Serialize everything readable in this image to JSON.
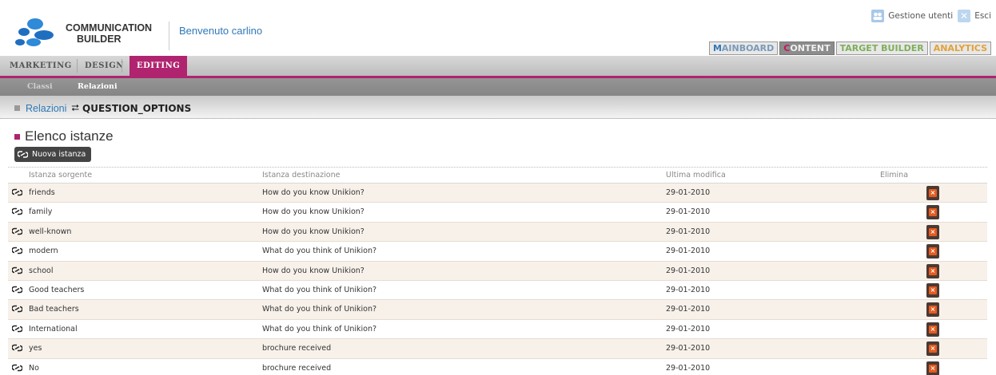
{
  "header": {
    "brand_line1": "COMMUNICATION",
    "brand_line2": "BUILDER",
    "welcome": "Benvenuto carlino",
    "user_management": "Gestione utenti",
    "logout": "Esci"
  },
  "app_tabs": [
    {
      "first": "M",
      "rest": "AINBOARD"
    },
    {
      "first": "C",
      "rest": "ONTENT"
    },
    {
      "first": "T",
      "rest": "ARGET BUILDER"
    },
    {
      "first": "A",
      "rest": "NALYTICS"
    }
  ],
  "nav": {
    "marketing": "MARKETING",
    "design": "DESIGN",
    "editing": "EDITING"
  },
  "subnav": {
    "classi": "Classi",
    "relazioni": "Relazioni"
  },
  "breadcrumb": {
    "link": "Relazioni",
    "current": "QUESTION_OPTIONS"
  },
  "section": {
    "title": "Elenco istanze",
    "new_button": "Nuova istanza"
  },
  "table": {
    "headers": {
      "source": "Istanza sorgente",
      "destination": "Istanza destinazione",
      "modified": "Ultima modifica",
      "delete": "Elimina"
    },
    "rows": [
      {
        "source": "friends",
        "destination": "How do you know Unikion?",
        "modified": "29-01-2010"
      },
      {
        "source": "family",
        "destination": "How do you know Unikion?",
        "modified": "29-01-2010"
      },
      {
        "source": "well-known",
        "destination": "How do you know Unikion?",
        "modified": "29-01-2010"
      },
      {
        "source": "modern",
        "destination": "What do you think of Unikion?",
        "modified": "29-01-2010"
      },
      {
        "source": "school",
        "destination": "How do you know Unikion?",
        "modified": "29-01-2010"
      },
      {
        "source": "Good teachers",
        "destination": "What do you think of Unikion?",
        "modified": "29-01-2010"
      },
      {
        "source": "Bad teachers",
        "destination": "What do you think of Unikion?",
        "modified": "29-01-2010"
      },
      {
        "source": "International",
        "destination": "What do you think of Unikion?",
        "modified": "29-01-2010"
      },
      {
        "source": "yes",
        "destination": "brochure received",
        "modified": "29-01-2010"
      },
      {
        "source": "No",
        "destination": "brochure received",
        "modified": "29-01-2010"
      }
    ]
  },
  "colors": {
    "accent": "#b0246f",
    "link": "#2f78b7",
    "delete": "#e65a1f"
  },
  "icons": {
    "link": "link-icon",
    "delete": "delete-icon",
    "users": "users-icon",
    "exit": "exit-icon"
  }
}
